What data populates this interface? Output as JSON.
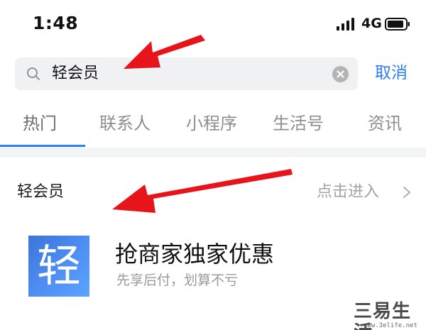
{
  "status_bar": {
    "time": "1:48",
    "network": "4G"
  },
  "search": {
    "value": "轻会员",
    "cancel_label": "取消"
  },
  "tabs": [
    {
      "label": "热门",
      "active": true
    },
    {
      "label": "联系人",
      "active": false
    },
    {
      "label": "小程序",
      "active": false
    },
    {
      "label": "生活号",
      "active": false
    },
    {
      "label": "资讯",
      "active": false
    }
  ],
  "section": {
    "title": "轻会员",
    "enter_label": "点击进入"
  },
  "result": {
    "logo_char": "轻",
    "title": "抢商家独家优惠",
    "subtitle": "先享后付，划算不亏"
  },
  "watermark": {
    "text": "三易生活",
    "url": "www.3elife.net"
  },
  "colors": {
    "accent": "#2e7cf6",
    "annotation": "#e8141c"
  },
  "icons": [
    "signal-icon",
    "battery-icon",
    "search-icon",
    "clear-icon",
    "chevron-right-icon"
  ]
}
